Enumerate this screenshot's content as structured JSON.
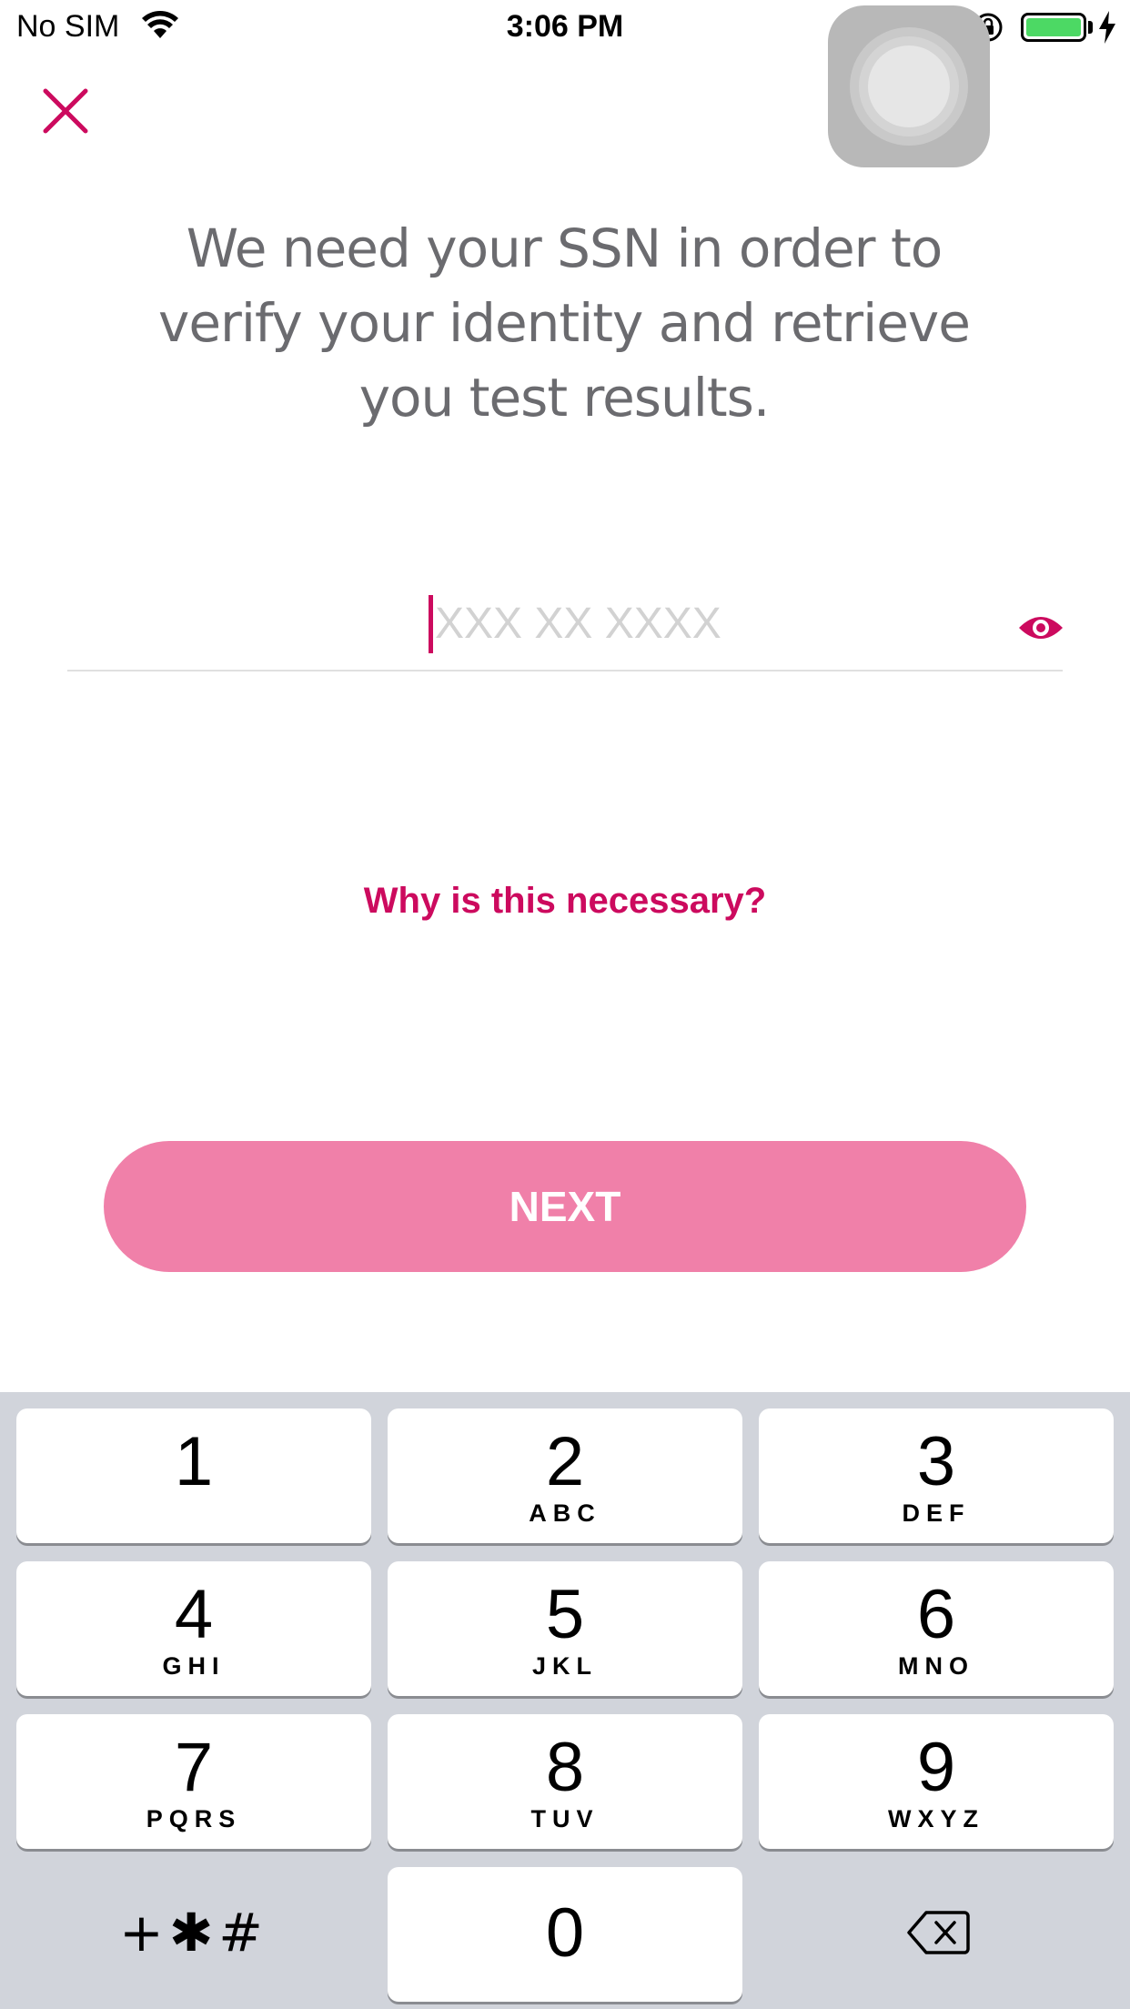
{
  "status_bar": {
    "carrier": "No SIM",
    "time": "3:06 PM",
    "battery_level": 1.0,
    "battery_color": "#4cd964"
  },
  "header": {
    "close_icon": "close-icon"
  },
  "main": {
    "title": "We need your SSN in order to verify your identity and retrieve you test results.",
    "ssn_field": {
      "value": "",
      "placeholder": "XXX XX XXXX",
      "toggle_icon": "eye-icon"
    },
    "why_link": "Why is this necessary?",
    "next_label": "NEXT"
  },
  "keyboard": {
    "keys": [
      {
        "digit": "1",
        "letters": ""
      },
      {
        "digit": "2",
        "letters": "ABC"
      },
      {
        "digit": "3",
        "letters": "DEF"
      },
      {
        "digit": "4",
        "letters": "GHI"
      },
      {
        "digit": "5",
        "letters": "JKL"
      },
      {
        "digit": "6",
        "letters": "MNO"
      },
      {
        "digit": "7",
        "letters": "PQRS"
      },
      {
        "digit": "8",
        "letters": "TUV"
      },
      {
        "digit": "9",
        "letters": "WXYZ"
      },
      {
        "digit": "0",
        "letters": ""
      }
    ],
    "symbols_label": "+✱#",
    "delete_icon": "backspace-icon"
  },
  "colors": {
    "accent": "#cc0a5e",
    "button": "#f080a9",
    "title_text": "#6b6b6f",
    "keyboard_bg": "#d1d4db"
  }
}
